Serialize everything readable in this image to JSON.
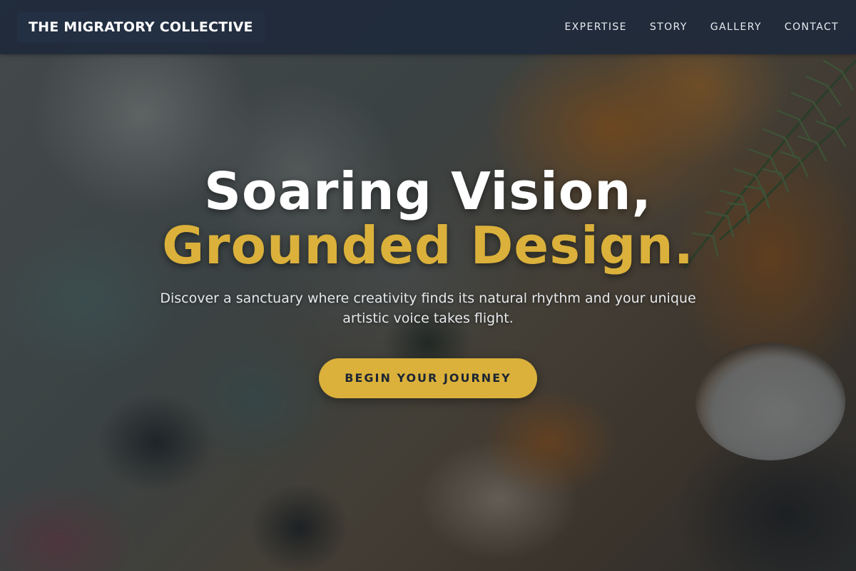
{
  "navbar": {
    "brand": "THE MIGRATORY COLLECTIVE",
    "links": [
      {
        "label": "EXPERTISE"
      },
      {
        "label": "STORY"
      },
      {
        "label": "GALLERY"
      },
      {
        "label": "CONTACT"
      }
    ]
  },
  "hero": {
    "headline_line1": "Soaring Vision,",
    "headline_line2": "Grounded Design.",
    "subtitle": "Discover a sanctuary where creativity finds its natural rhythm and your unique artistic voice takes flight.",
    "cta_label": "BEGIN YOUR JOURNEY",
    "background": "painted-canvas-texture"
  },
  "colors": {
    "accent_gold": "#dbb13b",
    "navbar_bg": "#1e293b",
    "headline_white": "#ffffff",
    "cta_text": "#1c2533"
  }
}
